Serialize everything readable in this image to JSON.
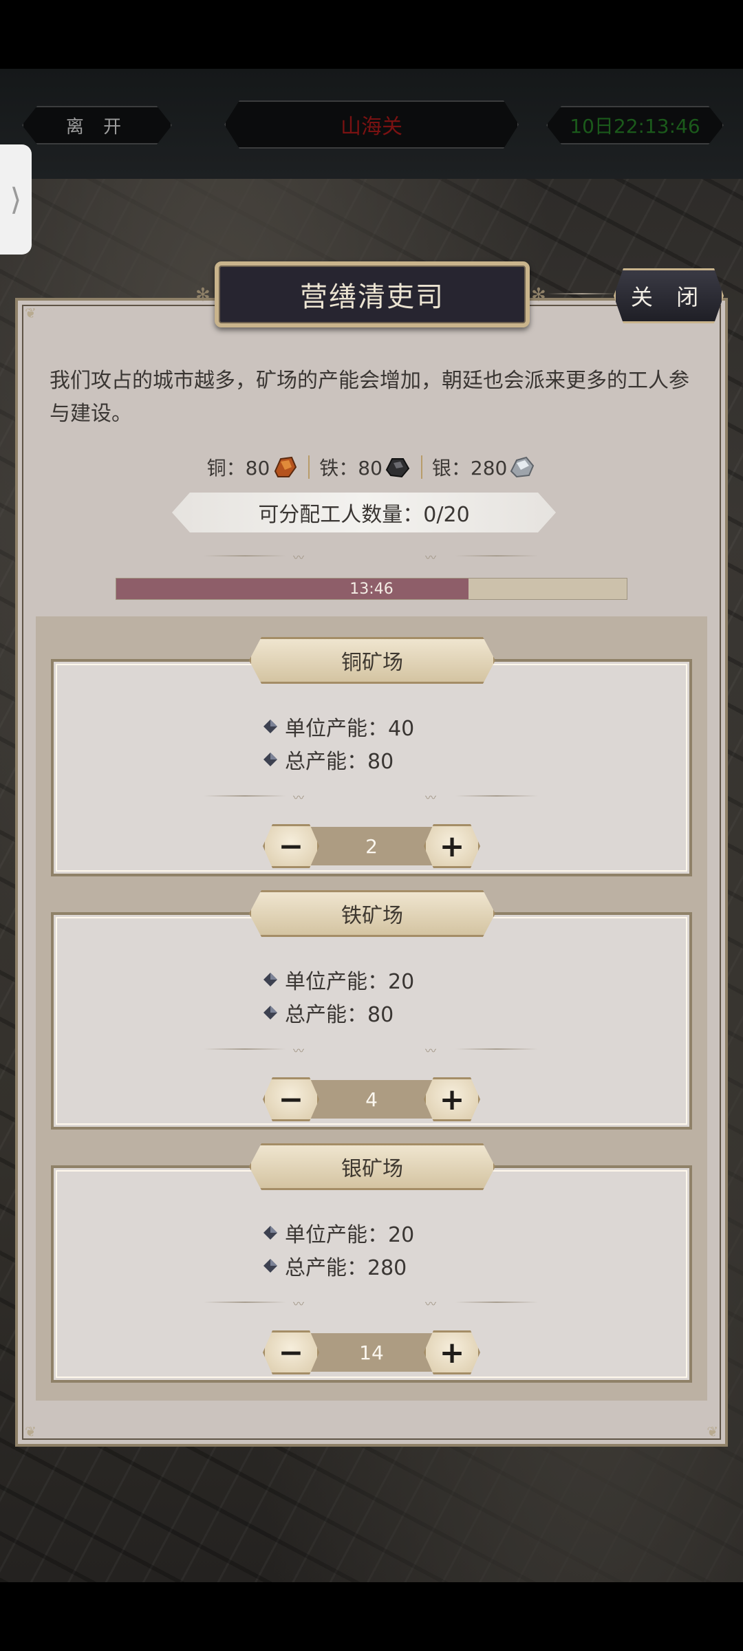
{
  "topbar": {
    "leave_label": "离 开",
    "city_name": "山海关",
    "clock": "10日22:13:46"
  },
  "side_tab": {
    "glyph": "⟩"
  },
  "panel": {
    "title": "营缮清吏司",
    "close_label": "关 闭",
    "description": "我们攻占的城市越多，矿场的产能会增加，朝廷也会派来更多的工人参与建设。",
    "resources": [
      {
        "label": "铜：80",
        "icon": "copper-ore-icon"
      },
      {
        "label": "铁：80",
        "icon": "iron-ore-icon"
      },
      {
        "label": "银：280",
        "icon": "silver-ore-icon"
      }
    ],
    "workers": "可分配工人数量：0/20",
    "timer": {
      "text": "13:46",
      "progress": 0.69
    }
  },
  "mines": [
    {
      "name": "铜矿场",
      "unit": "单位产能：40",
      "total": "总产能：80",
      "workers": "2"
    },
    {
      "name": "铁矿场",
      "unit": "单位产能：20",
      "total": "总产能：80",
      "workers": "4"
    },
    {
      "name": "银矿场",
      "unit": "单位产能：20",
      "total": "总产能：280",
      "workers": "14"
    }
  ],
  "stepper": {
    "minus": "−",
    "plus": "+"
  },
  "colors": {
    "accent_gold": "#c9b48c",
    "panel_bg": "#cbc3be",
    "progress_fill": "#8e5e69",
    "city_red": "#7a1212",
    "clock_green": "#1b5a1b"
  }
}
